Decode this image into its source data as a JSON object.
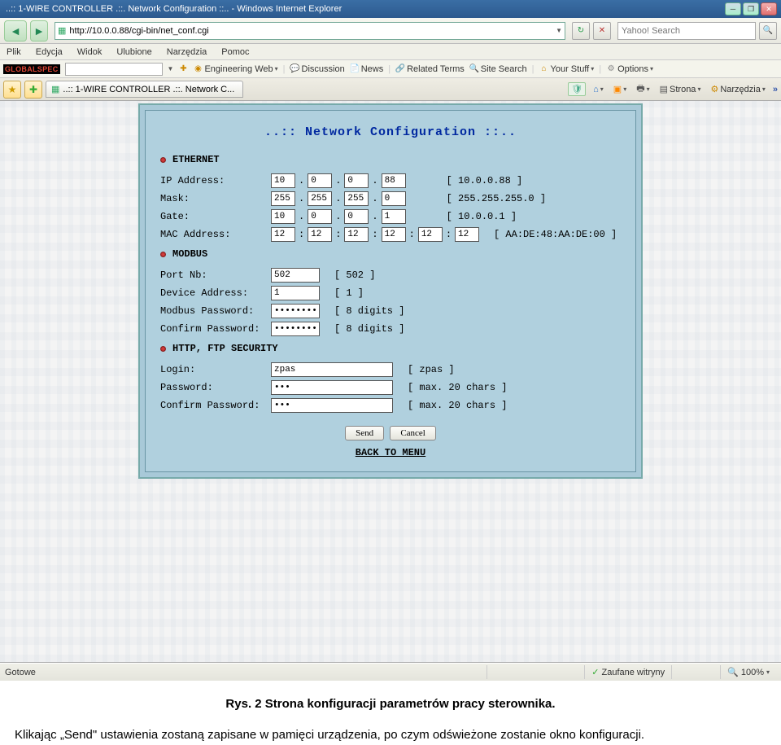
{
  "titlebar": {
    "text": "..:: 1-WIRE CONTROLLER .::. Network Configuration ::.. - Windows Internet Explorer"
  },
  "nav": {
    "url": "http://10.0.0.88/cgi-bin/net_conf.cgi",
    "search_placeholder": "Yahoo! Search"
  },
  "menu": {
    "items": [
      "Plik",
      "Edycja",
      "Widok",
      "Ulubione",
      "Narzędzia",
      "Pomoc"
    ]
  },
  "linkbar": {
    "engineering": "Engineering Web",
    "discussion": "Discussion",
    "news": "News",
    "related": "Related Terms",
    "site": "Site Search",
    "stuff": "Your Stuff",
    "options": "Options"
  },
  "tabbar": {
    "tab_label": "..:: 1-WIRE CONTROLLER .::. Network C...",
    "strona": "Strona",
    "narzedzia": "Narzędzia"
  },
  "panel": {
    "title": "..:: Network Configuration ::..",
    "ethernet": {
      "heading": "ETHERNET",
      "ip": {
        "label": "IP Address:",
        "o": [
          "10",
          "0",
          "0",
          "88"
        ],
        "hint": "[ 10.0.0.88 ]"
      },
      "mask": {
        "label": "Mask:",
        "o": [
          "255",
          "255",
          "255",
          "0"
        ],
        "hint": "[ 255.255.255.0 ]"
      },
      "gate": {
        "label": "Gate:",
        "o": [
          "10",
          "0",
          "0",
          "1"
        ],
        "hint": "[ 10.0.0.1 ]"
      },
      "mac": {
        "label": "MAC Address:",
        "o": [
          "12",
          "12",
          "12",
          "12",
          "12",
          "12"
        ],
        "hint": "[ AA:DE:48:AA:DE:00 ]"
      }
    },
    "modbus": {
      "heading": "MODBUS",
      "port": {
        "label": "Port Nb:",
        "value": "502",
        "hint": "[ 502 ]"
      },
      "dev": {
        "label": "Device Address:",
        "value": "1",
        "hint": "[ 1 ]"
      },
      "pw": {
        "label": "Modbus Password:",
        "value": "••••••••",
        "hint": "[ 8 digits ]"
      },
      "cpw": {
        "label": "Confirm Password:",
        "value": "••••••••",
        "hint": "[ 8 digits ]"
      }
    },
    "http": {
      "heading": "HTTP, FTP SECURITY",
      "login": {
        "label": "Login:",
        "value": "zpas",
        "hint": "[ zpas ]"
      },
      "pw": {
        "label": "Password:",
        "value": "•••",
        "hint": "[ max. 20 chars ]"
      },
      "cpw": {
        "label": "Confirm Password:",
        "value": "•••",
        "hint": "[ max. 20 chars ]"
      }
    },
    "buttons": {
      "send": "Send",
      "cancel": "Cancel"
    },
    "back": "BACK TO MENU"
  },
  "status": {
    "left": "Gotowe",
    "trusted": "Zaufane witryny",
    "zoom": "100%"
  },
  "captions": {
    "c1": "Rys. 2 Strona konfiguracji parametrów pracy sterownika.",
    "c2": "Klikając „Send\" ustawienia zostaną zapisane w pamięci urządzenia, po czym odświeżone zostanie okno konfiguracji."
  }
}
